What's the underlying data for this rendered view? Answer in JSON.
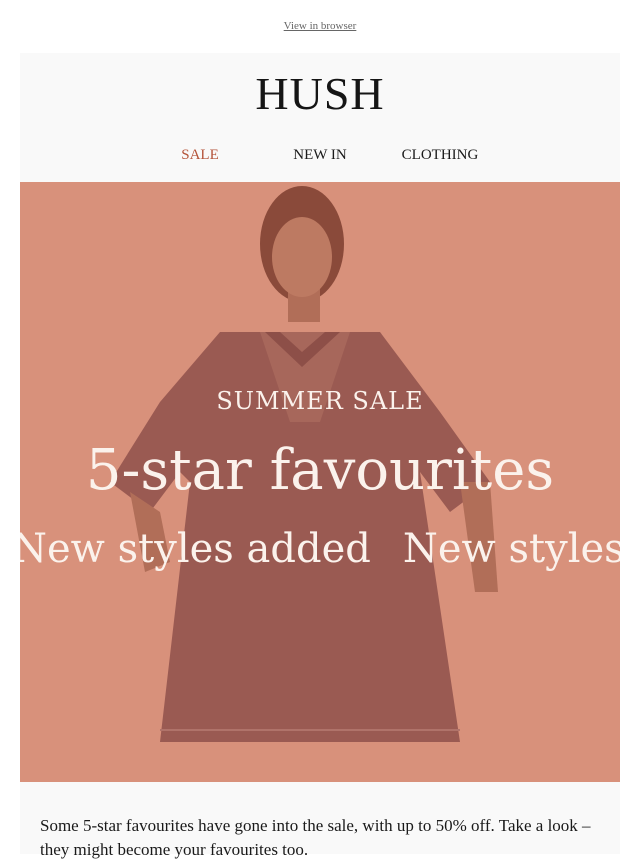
{
  "preheader": {
    "view_in_browser": "View in browser"
  },
  "brand": {
    "logo": "HUSH"
  },
  "nav": {
    "items": [
      {
        "label": "SALE"
      },
      {
        "label": "NEW IN"
      },
      {
        "label": "CLOTHING"
      }
    ]
  },
  "hero": {
    "overline": "SUMMER SALE",
    "title": "5-star favourites",
    "marquee": [
      "New styles added",
      "New styles added"
    ]
  },
  "body": {
    "paragraph": "Some 5-star favourites have gone into the sale, with up to 50% off. Take a look – they might become your favourites too."
  },
  "colors": {
    "accent_sale": "#b4543a",
    "hero_tint": "#d8917b",
    "card_bg": "#f9f9f9"
  }
}
